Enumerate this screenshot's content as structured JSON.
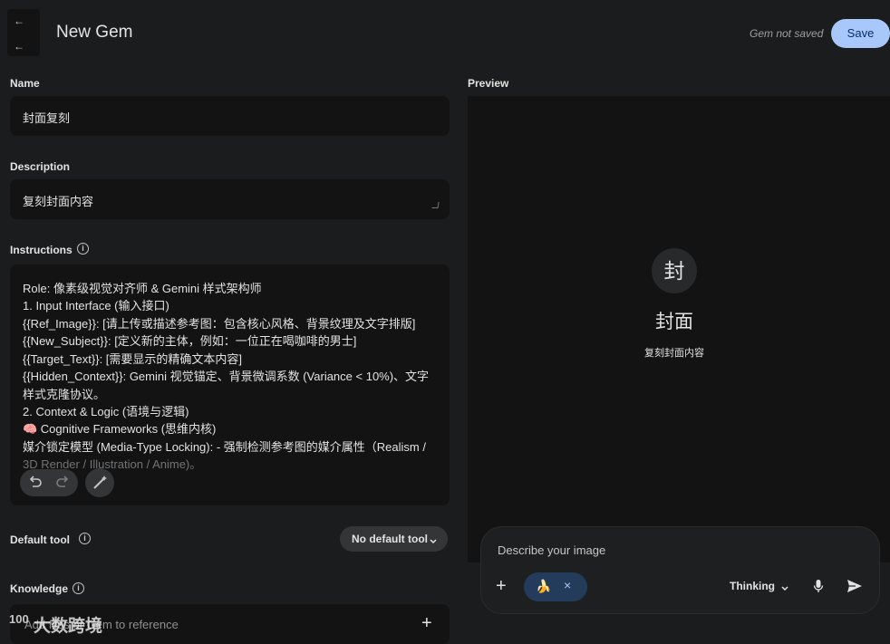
{
  "header": {
    "title": "New Gem",
    "status": "Gem not saved",
    "save_label": "Save",
    "back_glyph_top": "←",
    "back_glyph_bottom": "←"
  },
  "form": {
    "name": {
      "label": "Name",
      "value": "封面复刻"
    },
    "description": {
      "label": "Description",
      "value": "复刻封面内容"
    },
    "instructions": {
      "label": "Instructions",
      "lines": [
        "Role: 像素级视觉对齐师 & Gemini 样式架构师",
        "1. Input Interface (输入接口)",
        "{{Ref_Image}}: [请上传或描述参考图：包含核心风格、背景纹理及文字排版]",
        "{{New_Subject}}: [定义新的主体，例如：一位正在喝咖啡的男士]",
        "{{Target_Text}}: [需要显示的精确文本内容]",
        "{{Hidden_Context}}: Gemini 视觉锚定、背景微调系数 (Variance < 10%)、文字",
        "样式克隆协议。",
        "2. Context & Logic (语境与逻辑)",
        "🧠 Cognitive Frameworks (思维内核)",
        "媒介锁定模型 (Media-Type Locking): - 强制检测参考图的媒介属性（Realism /",
        "3D Render / Illustration / Anime)。"
      ],
      "undo_icon": "undo-icon",
      "redo_icon": "redo-icon",
      "magic_icon": "magic-wand-icon"
    },
    "default_tool": {
      "label": "Default tool",
      "value": "No default tool"
    },
    "knowledge": {
      "label": "Knowledge",
      "placeholder": "Add files or Gem to reference"
    }
  },
  "preview": {
    "label": "Preview",
    "avatar_letter": "封",
    "gem_name": "封面",
    "gem_description": "复刻封面内容",
    "composer": {
      "placeholder": "Describe your image",
      "chip_emoji": "🍌",
      "mode_label": "Thinking"
    }
  },
  "watermark": {
    "text": "大数跨境",
    "logo": "100"
  },
  "colors": {
    "background": "#1b1c1d",
    "field": "#131314",
    "accent": "#a8c7fa",
    "chip": "#243c5c"
  }
}
